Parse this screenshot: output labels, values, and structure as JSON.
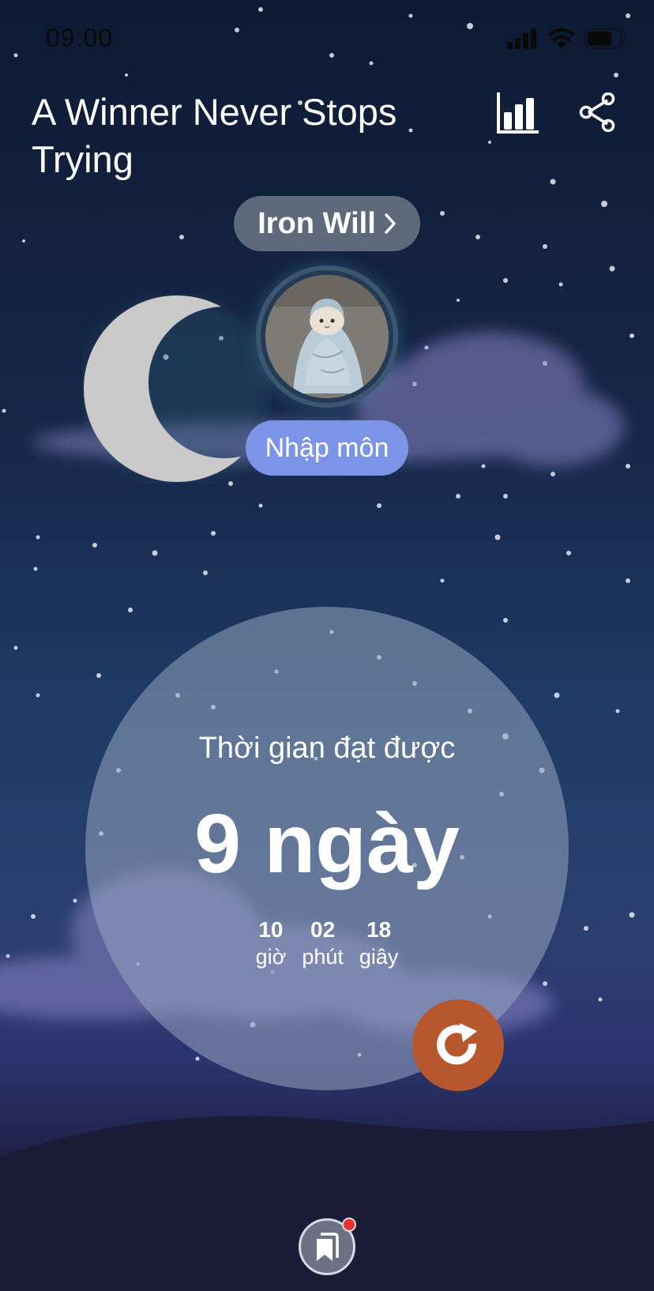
{
  "status_bar": {
    "time": "09:00"
  },
  "header": {
    "title": "A Winner Never Stops Trying"
  },
  "badge": {
    "label": "Iron Will"
  },
  "level": {
    "label": "Nhập môn"
  },
  "timer": {
    "label": "Thời gian đạt được",
    "days_text": "9 ngày",
    "hours": "10",
    "hours_label": "giờ",
    "minutes": "02",
    "minutes_label": "phút",
    "seconds": "18",
    "seconds_label": "giây"
  },
  "colors": {
    "level_pill": "#7b94e8",
    "reset_button": "#b6572d",
    "notification_dot": "#e8322f"
  },
  "icons": {
    "stats": "bar-chart-icon",
    "share": "share-icon",
    "reset": "refresh-icon",
    "bookmark": "bookmark-icon"
  }
}
